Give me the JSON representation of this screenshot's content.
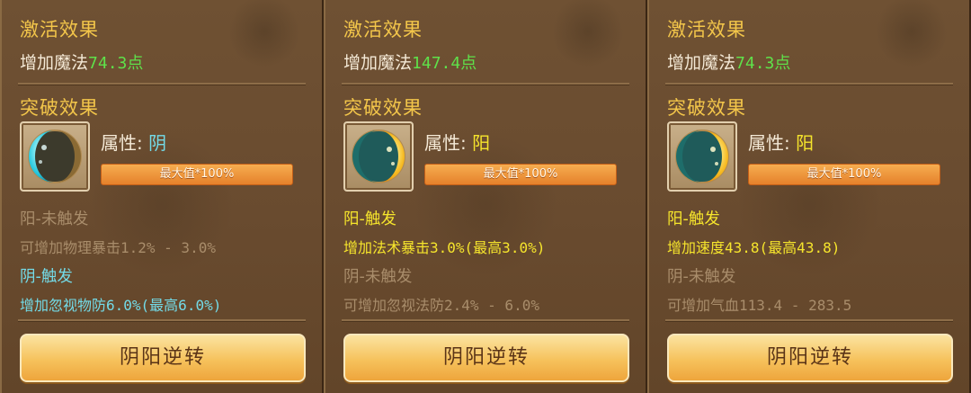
{
  "panels": [
    {
      "activation_title": "激活效果",
      "activation_prefix": "增加魔法",
      "activation_value": "74.3点",
      "breakthrough_title": "突破效果",
      "attr_label": "属性: ",
      "attr_value": "阴",
      "attr_color": "#73dbe8",
      "bar_label": "最大值*100%",
      "icon": "yin-moon-icon",
      "effects": [
        {
          "title": "阳-未触发",
          "desc": "可增加物理暴击1.2% - 3.0%",
          "title_state": "dim",
          "desc_state": "dim"
        },
        {
          "title": "阴-触发",
          "desc": "增加忽视物防6.0%",
          "desc_highlight": "(最高6.0%)",
          "title_state": "cyan",
          "desc_state": "cyan"
        }
      ],
      "button_label": "阴阳逆转"
    },
    {
      "activation_title": "激活效果",
      "activation_prefix": "增加魔法",
      "activation_value": "147.4点",
      "breakthrough_title": "突破效果",
      "attr_label": "属性: ",
      "attr_value": "阳",
      "attr_color": "#f6e52c",
      "bar_label": "最大值*100%",
      "icon": "yang-moon-icon",
      "effects": [
        {
          "title": "阳-触发",
          "desc": "增加法术暴击3.0%",
          "desc_highlight": "(最高3.0%)",
          "title_state": "yellow",
          "desc_state": "yellow"
        },
        {
          "title": "阴-未触发",
          "desc": "可增加忽视法防2.4% - 6.0%",
          "title_state": "dim",
          "desc_state": "dim"
        }
      ],
      "button_label": "阴阳逆转"
    },
    {
      "activation_title": "激活效果",
      "activation_prefix": "增加魔法",
      "activation_value": "74.3点",
      "breakthrough_title": "突破效果",
      "attr_label": "属性: ",
      "attr_value": "阳",
      "attr_color": "#f6e52c",
      "bar_label": "最大值*100%",
      "icon": "yang-moon-icon",
      "effects": [
        {
          "title": "阳-触发",
          "desc": "增加速度43.8",
          "desc_highlight": "(最高43.8)",
          "title_state": "yellow",
          "desc_state": "yellow"
        },
        {
          "title": "阴-未触发",
          "desc": "可增加气血113.4 - 283.5",
          "title_state": "dim",
          "desc_state": "dim"
        }
      ],
      "button_label": "阴阳逆转"
    }
  ],
  "colors": {
    "title_gold": "#f3c64a",
    "value_green": "#5fe14a",
    "inactive": "#a98d6b",
    "yin_cyan": "#73dbe8",
    "yang_yellow": "#f6e52c",
    "panel_brown": "#6a4c30",
    "button_orange": "#f6c25c"
  }
}
